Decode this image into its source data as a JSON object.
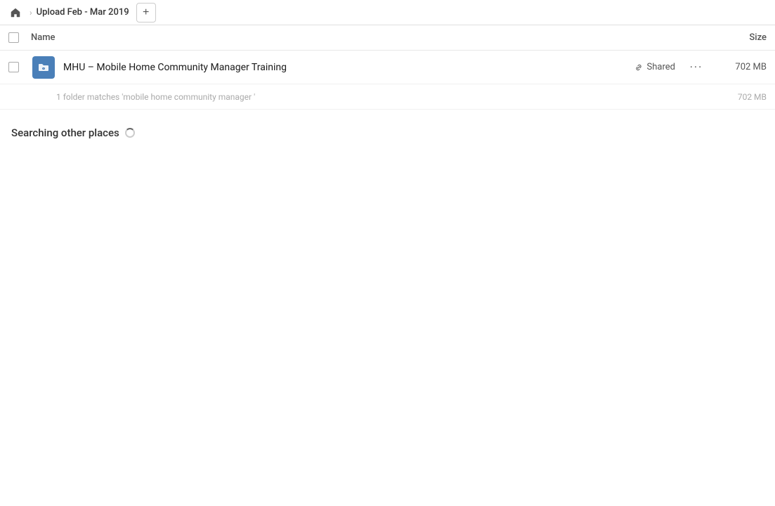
{
  "topbar": {
    "home_icon": "home",
    "breadcrumb_label": "Upload Feb - Mar 2019",
    "add_button_label": "+"
  },
  "columns": {
    "name_label": "Name",
    "size_label": "Size"
  },
  "file_row": {
    "name": "MHU – Mobile Home Community Manager Training",
    "shared_label": "Shared",
    "size": "702 MB",
    "more_label": "···"
  },
  "match_info": {
    "text": "1 folder matches 'mobile home community manager '",
    "size": "702 MB"
  },
  "searching": {
    "label": "Searching other places"
  }
}
